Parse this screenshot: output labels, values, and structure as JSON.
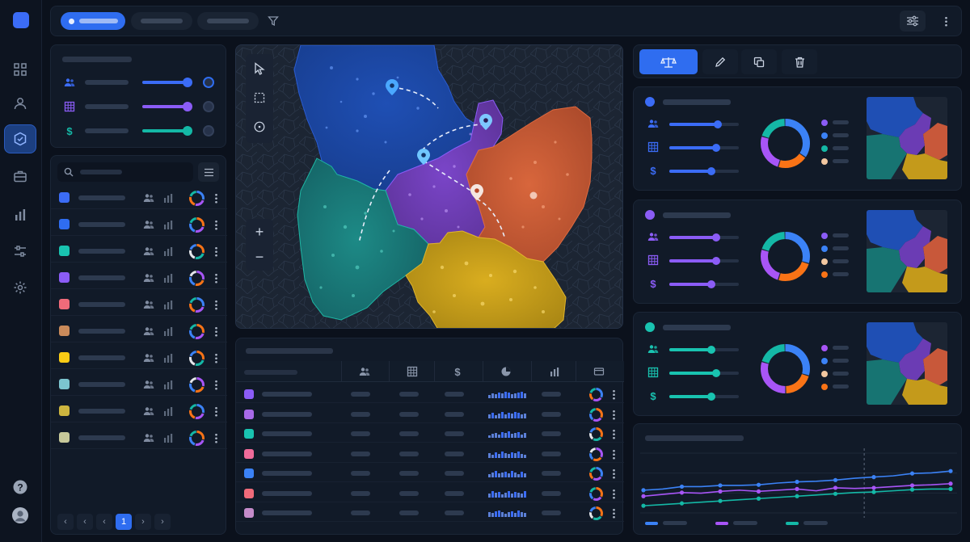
{
  "toolbar": {
    "tabs": [
      {
        "label": ""
      },
      {
        "label": ""
      },
      {
        "label": ""
      }
    ],
    "filter_icon": "filter-icon",
    "settings_icon": "sliders-icon",
    "more_icon": "kebab-icon"
  },
  "nav": {
    "items": [
      "grid-icon",
      "user-icon",
      "region-badge-icon",
      "briefcase-icon",
      "bar-chart-icon",
      "sliders-icon",
      "gear-icon"
    ],
    "bottom": [
      "help-icon",
      "avatar"
    ]
  },
  "filters": {
    "title": "",
    "sliders": [
      {
        "icon": "users-icon",
        "color": "#3b6cf6",
        "level": 0.9
      },
      {
        "icon": "grid-icon",
        "color": "#8b5cf6",
        "level": 0.9
      },
      {
        "icon": "dollar-icon",
        "color": "#14b8a6",
        "level": 0.9
      }
    ]
  },
  "region_list": {
    "search_placeholder": "",
    "items": [
      {
        "color": "#3b6cf6"
      },
      {
        "color": "#2f6df0"
      },
      {
        "color": "#19c3b0"
      },
      {
        "color": "#8b5cf6"
      },
      {
        "color": "#f06b7a"
      },
      {
        "color": "#c98a5a"
      },
      {
        "color": "#facc15"
      },
      {
        "color": "#7cc5d0"
      },
      {
        "color": "#cdb53f"
      },
      {
        "color": "#c7c99a"
      }
    ],
    "pagination": {
      "current": "1"
    }
  },
  "map": {
    "tools": [
      "cursor-icon",
      "select-rect-icon",
      "compass-icon"
    ],
    "zoom_in": "+",
    "zoom_out": "−"
  },
  "table": {
    "title": "",
    "columns": [
      "users-icon",
      "grid-icon",
      "$",
      "pie-icon",
      "bar-chart-icon",
      "card-icon"
    ],
    "rows": [
      {
        "color": "#8b5cf6"
      },
      {
        "color": "#a86ae8"
      },
      {
        "color": "#19c3b0"
      },
      {
        "color": "#f06b9a"
      },
      {
        "color": "#3b82f6"
      },
      {
        "color": "#f06b7a"
      },
      {
        "color": "#c48bc9"
      }
    ]
  },
  "actions": [
    "balance-scale-icon",
    "pencil-icon",
    "duplicate-icon",
    "trash-icon"
  ],
  "region_cards": [
    {
      "color": "#3b6cf6",
      "levels": [
        0.7,
        0.68,
        0.6
      ],
      "slices": [
        0.35,
        0.2,
        0.25,
        0.2
      ]
    },
    {
      "color": "#8b5cf6",
      "levels": [
        0.68,
        0.68,
        0.6
      ],
      "slices": [
        0.3,
        0.25,
        0.25,
        0.2
      ]
    },
    {
      "color": "#19c3b0",
      "levels": [
        0.6,
        0.68,
        0.6
      ],
      "slices": [
        0.3,
        0.2,
        0.3,
        0.2
      ]
    }
  ],
  "trend": {
    "title": "",
    "series": [
      {
        "color": "#3b82f6",
        "values": [
          0.38,
          0.4,
          0.44,
          0.44,
          0.46,
          0.46,
          0.47,
          0.5,
          0.52,
          0.53,
          0.55,
          0.58,
          0.6,
          0.62,
          0.66,
          0.67,
          0.7
        ]
      },
      {
        "color": "#a855f7",
        "values": [
          0.28,
          0.31,
          0.34,
          0.33,
          0.36,
          0.38,
          0.36,
          0.38,
          0.4,
          0.37,
          0.42,
          0.41,
          0.42,
          0.44,
          0.46,
          0.47,
          0.49
        ]
      },
      {
        "color": "#14b8a6",
        "values": [
          0.12,
          0.14,
          0.16,
          0.18,
          0.2,
          0.22,
          0.24,
          0.26,
          0.28,
          0.3,
          0.32,
          0.34,
          0.35,
          0.37,
          0.39,
          0.4,
          0.4
        ]
      }
    ]
  }
}
